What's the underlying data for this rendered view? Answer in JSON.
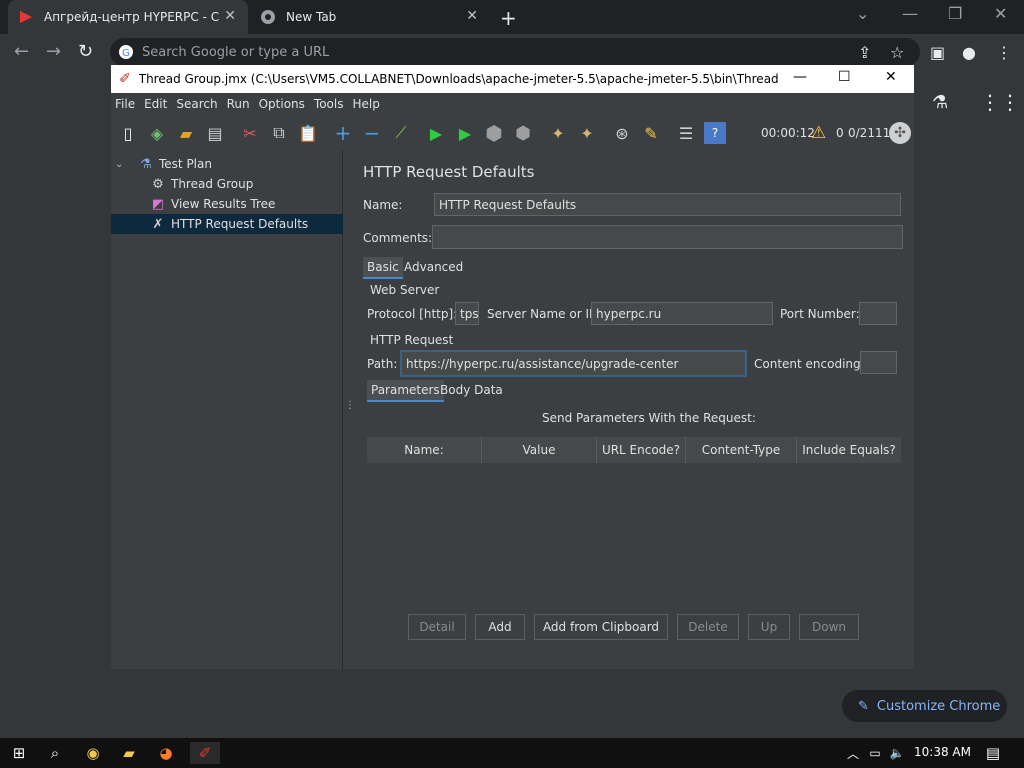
{
  "browser": {
    "tabs": [
      {
        "title": "Апгрейд-центр HYPERPC - С за",
        "active": true
      },
      {
        "title": "New Tab",
        "active": false
      }
    ],
    "new_tab_label": "+",
    "omnibox_placeholder": "Search Google or type a URL",
    "customize_label": "Customize Chrome"
  },
  "jmeter": {
    "window_title": "Thread Group.jmx (C:\\Users\\VM5.COLLABNET\\Downloads\\apache-jmeter-5.5\\apache-jmeter-5.5\\bin\\Thread Group.j...",
    "menu": [
      "File",
      "Edit",
      "Search",
      "Run",
      "Options",
      "Tools",
      "Help"
    ],
    "timer": "00:00:12",
    "error_count": "0",
    "thread_count": "0/2111",
    "tree": [
      {
        "label": "Test Plan",
        "level": 0,
        "icon": "flask-icon"
      },
      {
        "label": "Thread Group",
        "level": 1,
        "icon": "gear-icon"
      },
      {
        "label": "View Results Tree",
        "level": 1,
        "icon": "chart-icon"
      },
      {
        "label": "HTTP Request Defaults",
        "level": 1,
        "icon": "wrench-icon",
        "selected": true
      }
    ],
    "panel": {
      "title": "HTTP Request Defaults",
      "name_label": "Name:",
      "name_value": "HTTP Request Defaults",
      "comments_label": "Comments:",
      "comments_value": "",
      "tabs": [
        "Basic",
        "Advanced"
      ],
      "web_server_title": "Web Server",
      "protocol_label": "Protocol [http]:",
      "protocol_value": "tps",
      "server_label": "Server Name or IP:",
      "server_value": "hyperpc.ru",
      "port_label": "Port Number:",
      "port_value": "",
      "http_request_title": "HTTP Request",
      "path_label": "Path:",
      "path_value": "https://hyperpc.ru/assistance/upgrade-center",
      "encoding_label": "Content encoding:",
      "encoding_value": "",
      "sub_tabs": [
        "Parameters",
        "Body Data"
      ],
      "send_params_label": "Send Parameters With the Request:",
      "columns": [
        "Name:",
        "Value",
        "URL Encode?",
        "Content-Type",
        "Include Equals?"
      ],
      "buttons": [
        "Detail",
        "Add",
        "Add from Clipboard",
        "Delete",
        "Up",
        "Down"
      ]
    }
  },
  "taskbar": {
    "clock": "10:38 AM"
  }
}
